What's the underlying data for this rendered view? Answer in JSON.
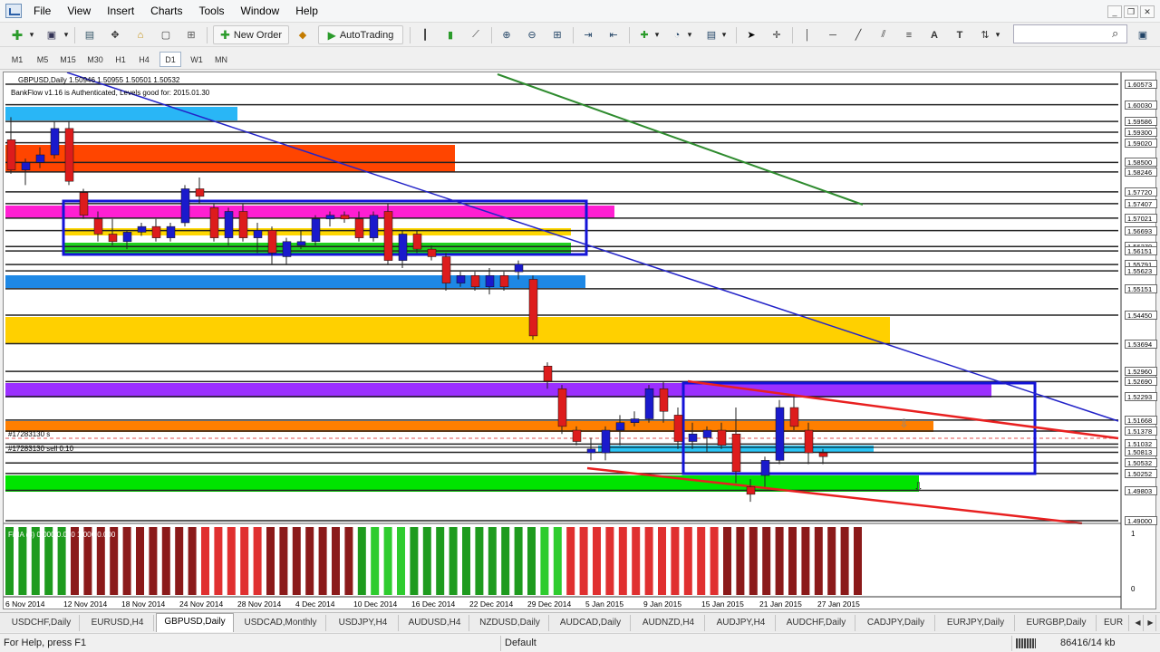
{
  "menu": [
    "File",
    "View",
    "Insert",
    "Charts",
    "Tools",
    "Window",
    "Help"
  ],
  "toolbar": {
    "new_order": "New Order",
    "autotrading": "AutoTrading"
  },
  "timeframes": [
    "M1",
    "M5",
    "M15",
    "M30",
    "H1",
    "H4",
    "D1",
    "W1",
    "MN"
  ],
  "active_timeframe": "D1",
  "chart": {
    "ohlc_line": "GBPUSD,Daily  1.50946 1.50955 1.50501 1.50532",
    "bankflow_line": "BankFlow v1.16 is Authenticated, Levels good for: 2015.01.30",
    "order_label_1": "#17283130 s",
    "order_label_2": "#17283130 sell 0.10",
    "indicator_label": "FiNA  (8) 0.000 0.000 1.000 0.000",
    "indicator_scale": [
      "1",
      "0"
    ],
    "price_labels": [
      "1.60573",
      "1.60030",
      "1.59586",
      "1.59300",
      "1.59020",
      "1.58500",
      "1.58246",
      "1.57720",
      "1.57407",
      "1.57021",
      "1.56693",
      "1.56270",
      "1.56151",
      "1.55791",
      "1.55623",
      "1.55151",
      "1.54450",
      "1.53694",
      "1.52960",
      "1.52690",
      "1.52293",
      "1.51668",
      "1.51378",
      "1.51032",
      "1.50813",
      "1.50532",
      "1.50252",
      "1.49803",
      "1.49000"
    ],
    "date_labels": [
      "6 Nov 2014",
      "12 Nov 2014",
      "18 Nov 2014",
      "24 Nov 2014",
      "28 Nov 2014",
      "4 Dec 2014",
      "10 Dec 2014",
      "16 Dec 2014",
      "22 Dec 2014",
      "29 Dec 2014",
      "5 Jan 2015",
      "9 Jan 2015",
      "15 Jan 2015",
      "21 Jan 2015",
      "27 Jan 2015"
    ],
    "candles": [
      [
        1.591,
        1.597,
        1.582,
        1.583
      ],
      [
        1.583,
        1.586,
        1.579,
        1.585
      ],
      [
        1.585,
        1.589,
        1.5835,
        1.587
      ],
      [
        1.587,
        1.596,
        1.586,
        1.594
      ],
      [
        1.594,
        1.596,
        1.579,
        1.58
      ],
      [
        1.577,
        1.578,
        1.57,
        1.571
      ],
      [
        1.57,
        1.572,
        1.564,
        1.566
      ],
      [
        1.566,
        1.57,
        1.563,
        1.564
      ],
      [
        1.564,
        1.567,
        1.562,
        1.5665
      ],
      [
        1.5665,
        1.569,
        1.5655,
        1.568
      ],
      [
        1.568,
        1.57,
        1.564,
        1.565
      ],
      [
        1.565,
        1.569,
        1.564,
        1.568
      ],
      [
        1.569,
        1.579,
        1.568,
        1.578
      ],
      [
        1.578,
        1.581,
        1.574,
        1.576
      ],
      [
        1.573,
        1.574,
        1.564,
        1.565
      ],
      [
        1.565,
        1.573,
        1.563,
        1.572
      ],
      [
        1.572,
        1.574,
        1.564,
        1.565
      ],
      [
        1.565,
        1.569,
        1.561,
        1.567
      ],
      [
        1.567,
        1.568,
        1.558,
        1.561
      ],
      [
        1.56,
        1.565,
        1.558,
        1.564
      ],
      [
        1.563,
        1.567,
        1.562,
        1.564
      ],
      [
        1.564,
        1.571,
        1.563,
        1.57
      ],
      [
        1.57,
        1.572,
        1.568,
        1.571
      ],
      [
        1.571,
        1.572,
        1.569,
        1.57
      ],
      [
        1.57,
        1.572,
        1.564,
        1.565
      ],
      [
        1.565,
        1.572,
        1.564,
        1.571
      ],
      [
        1.572,
        1.574,
        1.558,
        1.559
      ],
      [
        1.559,
        1.567,
        1.557,
        1.566
      ],
      [
        1.566,
        1.567,
        1.561,
        1.562
      ],
      [
        1.562,
        1.563,
        1.559,
        1.56
      ],
      [
        1.56,
        1.561,
        1.551,
        1.553
      ],
      [
        1.553,
        1.556,
        1.552,
        1.555
      ],
      [
        1.555,
        1.556,
        1.551,
        1.552
      ],
      [
        1.552,
        1.557,
        1.55,
        1.555
      ],
      [
        1.555,
        1.556,
        1.551,
        1.552
      ],
      [
        1.556,
        1.559,
        1.554,
        1.558
      ],
      [
        1.554,
        1.555,
        1.538,
        1.539
      ],
      [
        1.531,
        1.532,
        1.525,
        1.527
      ],
      [
        1.525,
        1.526,
        1.513,
        1.515
      ],
      [
        1.514,
        1.515,
        1.51,
        1.511
      ],
      [
        1.508,
        1.512,
        1.506,
        1.509
      ],
      [
        1.508,
        1.515,
        1.506,
        1.514
      ],
      [
        1.514,
        1.518,
        1.51,
        1.516
      ],
      [
        1.516,
        1.519,
        1.515,
        1.517
      ],
      [
        1.517,
        1.526,
        1.516,
        1.525
      ],
      [
        1.525,
        1.527,
        1.516,
        1.519
      ],
      [
        1.518,
        1.52,
        1.509,
        1.511
      ],
      [
        1.511,
        1.516,
        1.509,
        1.513
      ],
      [
        1.512,
        1.515,
        1.508,
        1.514
      ],
      [
        1.514,
        1.516,
        1.509,
        1.51
      ],
      [
        1.513,
        1.52,
        1.5,
        1.503
      ],
      [
        1.499,
        1.501,
        1.495,
        1.497
      ],
      [
        1.502,
        1.507,
        1.499,
        1.506
      ],
      [
        1.506,
        1.522,
        1.505,
        1.52
      ],
      [
        1.52,
        1.523,
        1.514,
        1.515
      ],
      [
        1.514,
        1.516,
        1.505,
        1.508
      ],
      [
        1.508,
        1.509,
        1.505,
        1.507
      ]
    ],
    "indicator_colors": [
      "#1e9b1e",
      "#1e9b1e",
      "#1e9b1e",
      "#1e9b1e",
      "#1e9b1e",
      "#8b1a1a",
      "#8b1a1a",
      "#8b1a1a",
      "#8b1a1a",
      "#8b1a1a",
      "#8b1a1a",
      "#8b1a1a",
      "#8b1a1a",
      "#8b1a1a",
      "#8b1a1a",
      "#e03030",
      "#e03030",
      "#e03030",
      "#e03030",
      "#e03030",
      "#8b1a1a",
      "#8b1a1a",
      "#8b1a1a",
      "#8b1a1a",
      "#8b1a1a",
      "#8b1a1a",
      "#8b1a1a",
      "#1e9b1e",
      "#2ecc2e",
      "#2ecc2e",
      "#2ecc2e",
      "#1e9b1e",
      "#1e9b1e",
      "#1e9b1e",
      "#1e9b1e",
      "#1e9b1e",
      "#1e9b1e",
      "#1e9b1e",
      "#1e9b1e",
      "#1e9b1e",
      "#1e9b1e",
      "#2ecc2e",
      "#2ecc2e",
      "#e03030",
      "#e03030",
      "#e03030",
      "#e03030",
      "#e03030",
      "#e03030",
      "#e03030",
      "#e03030",
      "#e03030",
      "#e03030",
      "#e03030",
      "#e03030",
      "#8b1a1a",
      "#8b1a1a",
      "#8b1a1a",
      "#8b1a1a",
      "#8b1a1a",
      "#8b1a1a",
      "#8b1a1a",
      "#8b1a1a",
      "#8b1a1a",
      "#8b1a1a",
      "#8b1a1a"
    ],
    "colors": {
      "bull": "#1a1acc",
      "bear": "#dd1c1c",
      "bg": "#ffffff"
    }
  },
  "tabs": [
    "USDCHF,Daily",
    "EURUSD,H4",
    "GBPUSD,Daily",
    "USDCAD,Monthly",
    "USDJPY,H4",
    "AUDUSD,H4",
    "NZDUSD,Daily",
    "AUDCAD,Daily",
    "AUDNZD,H4",
    "AUDJPY,H4",
    "AUDCHF,Daily",
    "CADJPY,Daily",
    "EURJPY,Daily",
    "EURGBP,Daily",
    "EUR"
  ],
  "active_tab": "GBPUSD,Daily",
  "status": {
    "help": "For Help, press F1",
    "profile": "Default",
    "traffic": "86416/14 kb"
  }
}
